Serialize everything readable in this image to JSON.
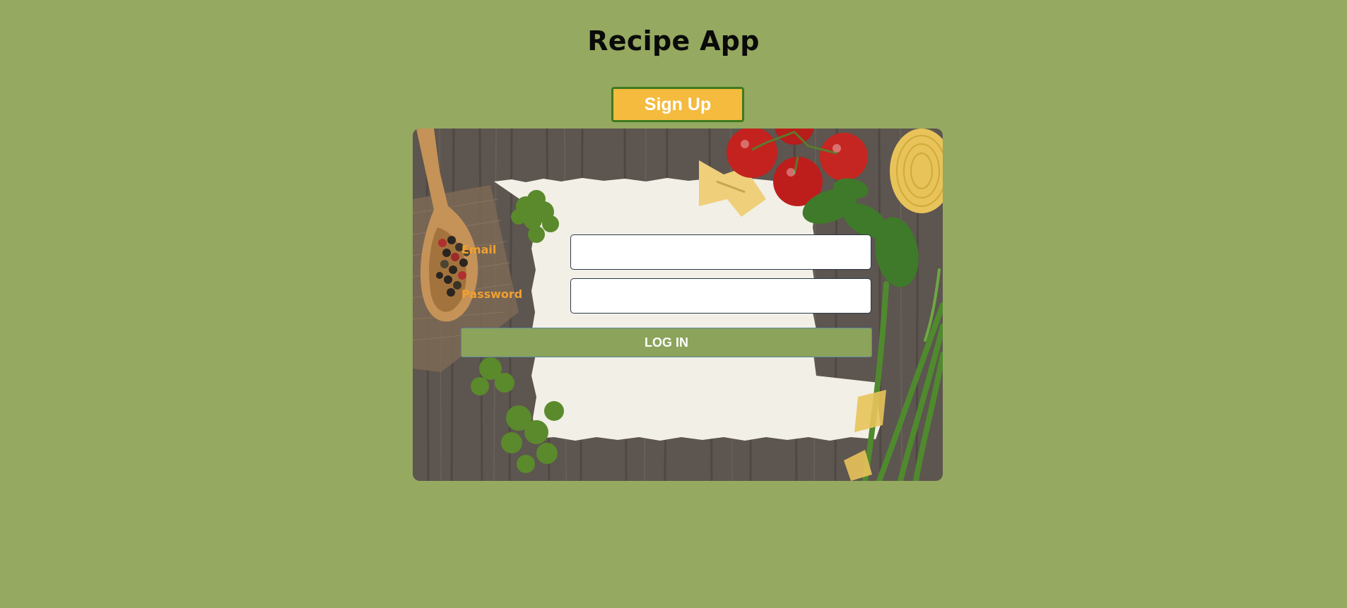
{
  "app": {
    "title": "Recipe App"
  },
  "header": {
    "signup_label": "Sign Up"
  },
  "login_form": {
    "email_label": "Email",
    "email_value": "",
    "email_placeholder": "",
    "password_label": "Password",
    "password_value": "",
    "password_placeholder": "",
    "login_label": "LOG IN"
  },
  "colors": {
    "page_background": "#95a960",
    "signup_background": "#f4bb3f",
    "signup_border": "#3f7a1e",
    "login_background": "#8ba35a",
    "label_color": "#f0a030"
  }
}
